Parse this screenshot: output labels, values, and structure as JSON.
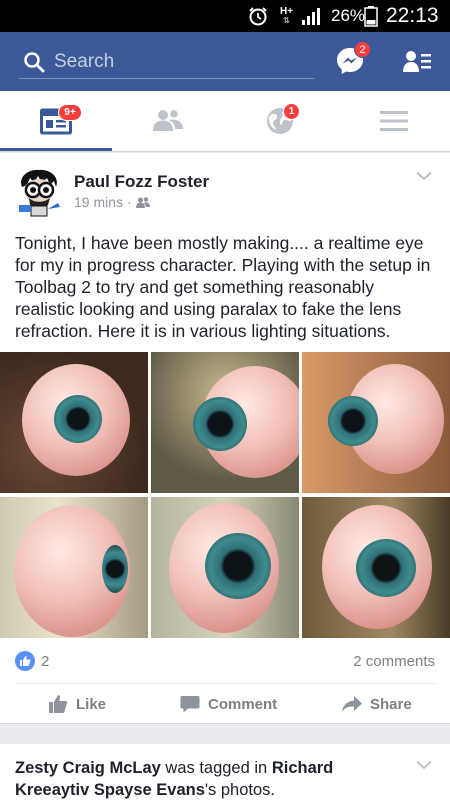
{
  "status_bar": {
    "network": "H+",
    "battery_percent": "26%",
    "time": "22:13"
  },
  "header": {
    "search_placeholder": "Search",
    "messenger_badge": "2"
  },
  "tabs": {
    "feed_badge": "9+",
    "notifications_badge": "1"
  },
  "post": {
    "author": "Paul Fozz Foster",
    "time": "19 mins",
    "privacy_icon": "friends-icon",
    "text": "Tonight, I have been mostly making.... a realtime eye for my in progress character. Playing with the setup in Toolbag 2 to try and get something reasonably realistic looking and using paralax to fake the lens refraction. Here it is in various lighting situations.",
    "like_count": "2",
    "comments": "2 comments",
    "actions": {
      "like": "Like",
      "comment": "Comment",
      "share": "Share"
    }
  },
  "post2": {
    "actor": "Zesty Craig McLay",
    "middle": " was tagged in ",
    "target": "Richard Kreeaytiv Spayse Evans",
    "suffix": "'s photos."
  },
  "colors": {
    "brand_blue": "#3b5998",
    "badge_red": "#fa3e3e",
    "like_blue": "#5890ff"
  }
}
